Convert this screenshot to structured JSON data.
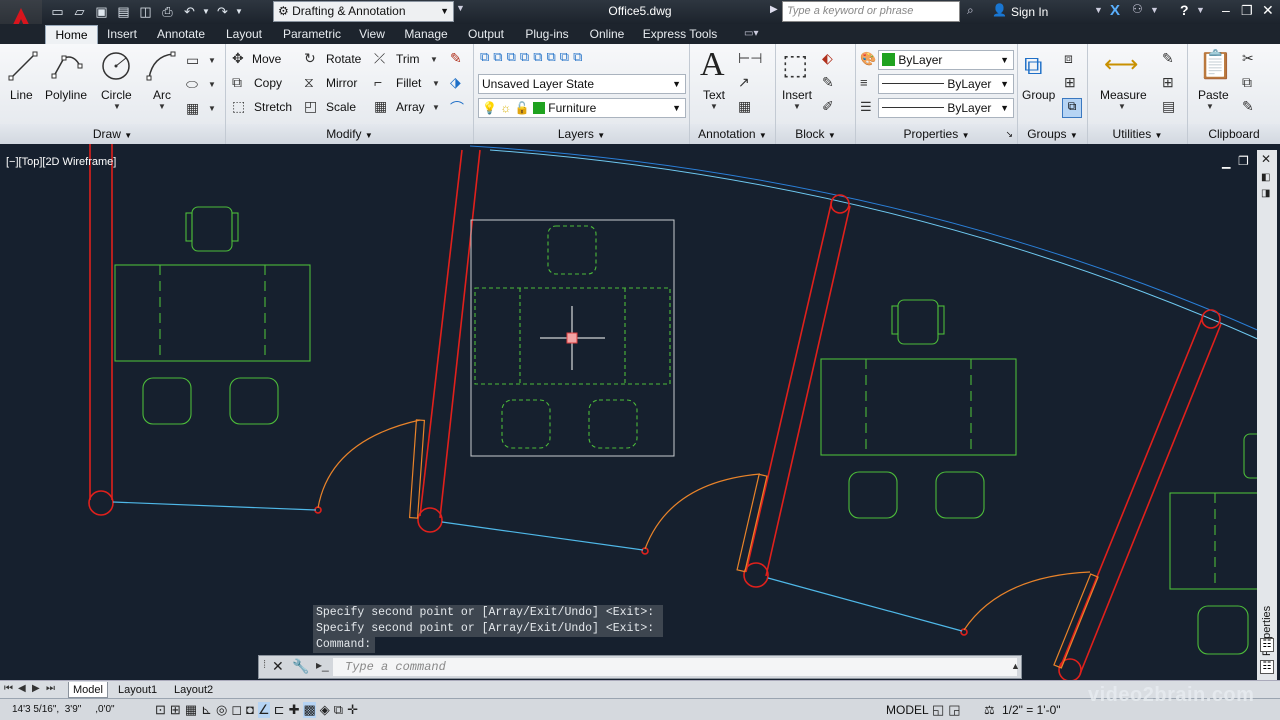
{
  "title_bar": {
    "workspace": "Drafting & Annotation",
    "file_name": "Office5.dwg",
    "search_placeholder": "Type a keyword or phrase",
    "sign_in": "Sign In"
  },
  "tabs": [
    "Home",
    "Insert",
    "Annotate",
    "Layout",
    "Parametric",
    "View",
    "Manage",
    "Output",
    "Plug-ins",
    "Online",
    "Express Tools"
  ],
  "active_tab": "Home",
  "ribbon": {
    "draw": {
      "title": "Draw",
      "line": "Line",
      "polyline": "Polyline",
      "circle": "Circle",
      "arc": "Arc"
    },
    "modify": {
      "title": "Modify",
      "move": "Move",
      "rotate": "Rotate",
      "trim": "Trim",
      "copy": "Copy",
      "mirror": "Mirror",
      "fillet": "Fillet",
      "stretch": "Stretch",
      "scale": "Scale",
      "array": "Array"
    },
    "layers": {
      "title": "Layers",
      "layer_state": "Unsaved Layer State",
      "current_layer": "Furniture"
    },
    "annotation": {
      "title": "Annotation",
      "text": "Text"
    },
    "block": {
      "title": "Block",
      "insert": "Insert"
    },
    "properties": {
      "title": "Properties",
      "color": "ByLayer",
      "linetype": "ByLayer",
      "lineweight": "ByLayer"
    },
    "groups": {
      "title": "Groups",
      "group": "Group"
    },
    "utilities": {
      "title": "Utilities",
      "measure": "Measure"
    },
    "clipboard": {
      "title": "Clipboard",
      "paste": "Paste"
    }
  },
  "viewport": {
    "label": "[−][Top][2D Wireframe]"
  },
  "command": {
    "history": [
      "Specify second point or [Array/Exit/Undo] <Exit>:",
      "Specify second point or [Array/Exit/Undo] <Exit>:",
      "Command:"
    ],
    "placeholder": "Type a command"
  },
  "layout_tabs": [
    "Model",
    "Layout1",
    "Layout2"
  ],
  "status_bar": {
    "coordinates": "14'3 5/16\",  3'9\"     ,0'0\"",
    "mode": "MODEL",
    "scale": "1/2\" = 1'-0\""
  },
  "side_palette": {
    "label": "Properties"
  },
  "watermark": "video2brain.com",
  "colors": {
    "accent": "#1e6fc7",
    "walls": "#e0201c",
    "furniture": "#4cbb3a",
    "door_swing": "#e8832a",
    "wall_edge": "#4fb8e8",
    "background": "#16202e"
  }
}
